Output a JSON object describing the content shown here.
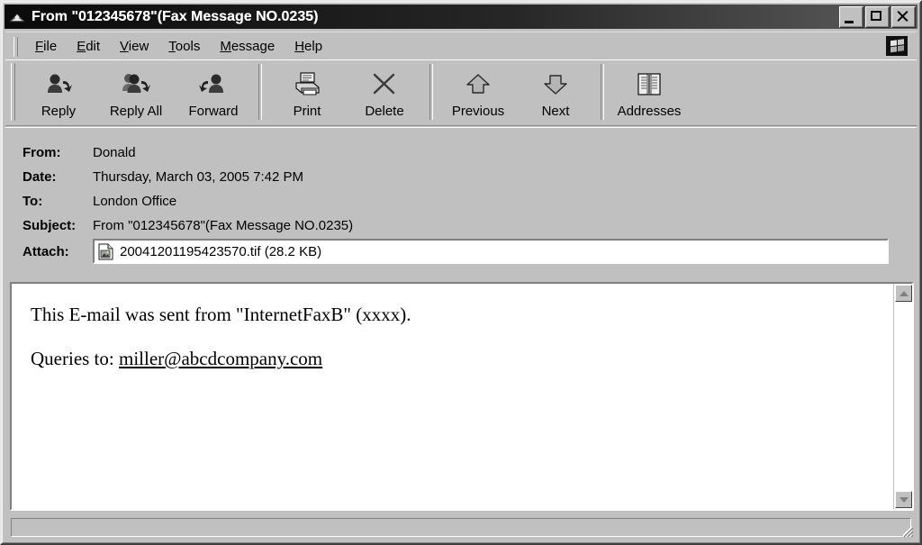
{
  "window": {
    "title": "From \"012345678\"(Fax Message NO.0235)",
    "title_icon": "envelope-icon",
    "caption_buttons": [
      {
        "name": "minimize",
        "label": "Minimize"
      },
      {
        "name": "maximize",
        "label": "Maximize"
      },
      {
        "name": "close",
        "label": "Close"
      }
    ]
  },
  "menubar": {
    "items": [
      {
        "accel": "F",
        "rest": "ile"
      },
      {
        "accel": "E",
        "rest": "dit"
      },
      {
        "accel": "V",
        "rest": "iew"
      },
      {
        "accel": "T",
        "rest": "ools"
      },
      {
        "accel": "M",
        "rest": "essage"
      },
      {
        "accel": "H",
        "rest": "elp"
      }
    ],
    "branding_icon": "windows-messenger-logo-icon"
  },
  "toolbar": {
    "buttons": [
      {
        "label": "Reply",
        "icon": "reply-icon"
      },
      {
        "label": "Reply All",
        "icon": "reply-all-icon"
      },
      {
        "label": "Forward",
        "icon": "forward-icon"
      },
      {
        "label": "Print",
        "icon": "printer-icon"
      },
      {
        "label": "Delete",
        "icon": "delete-x-icon"
      },
      {
        "label": "Previous",
        "icon": "arrow-up-icon"
      },
      {
        "label": "Next",
        "icon": "arrow-down-icon"
      },
      {
        "label": "Addresses",
        "icon": "address-book-icon"
      }
    ]
  },
  "header": {
    "from_label": "From:",
    "from_value": "Donald",
    "date_label": "Date:",
    "date_value": "Thursday, March 03, 2005 7:42 PM",
    "to_label": "To:",
    "to_value": "London Office",
    "subject_label": "Subject:",
    "subject_value": "From \"012345678\"(Fax Message NO.0235)",
    "attach_label": "Attach:",
    "attachment": {
      "filename": "20041201195423570.tif",
      "size": "28.2 KB",
      "display": "20041201195423570.tif (28.2 KB)",
      "icon": "tif-file-icon"
    }
  },
  "body": {
    "line1": "This E-mail was sent from \"InternetFaxB\" (xxxx).",
    "line2_prefix": "Queries to: ",
    "line2_link": "miller@abcdcompany.com"
  },
  "scrollbar": {
    "up_label": "Scroll up",
    "down_label": "Scroll down"
  },
  "statusbar": {
    "text": ""
  },
  "colors": {
    "face": "#c0c0c0",
    "titlebar_dark": "#0a0a0a",
    "titlebar_light": "#5c5c5c",
    "text": "#000000",
    "field_bg": "#ffffff"
  }
}
